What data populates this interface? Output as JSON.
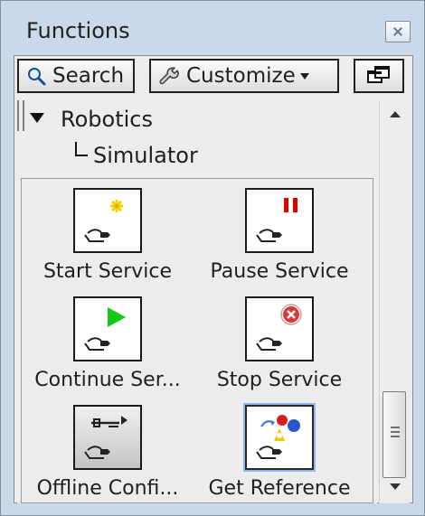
{
  "window": {
    "title": "Functions"
  },
  "toolbar": {
    "search_label": "Search",
    "customize_label": "Customize",
    "search_icon": "magnifier-icon",
    "customize_icon": "wrench-icon",
    "window_icon": "windows-icon"
  },
  "tree": {
    "root_label": "Robotics",
    "child_label": "Simulator"
  },
  "palette": {
    "items": [
      {
        "label": "Start Service",
        "icon": "start-service-icon"
      },
      {
        "label": "Pause Service",
        "icon": "pause-service-icon"
      },
      {
        "label": "Continue Ser...",
        "icon": "continue-service-icon"
      },
      {
        "label": "Stop Service",
        "icon": "stop-service-icon"
      },
      {
        "label": "Offline Confi...",
        "icon": "offline-config-icon"
      },
      {
        "label": "Get Reference",
        "icon": "get-reference-icon"
      }
    ]
  },
  "colors": {
    "frame": "#cad9ea",
    "panel": "#ececec",
    "accent_selection": "#8fb6e8",
    "start_icon_yellow": "#f2d400",
    "pause_icon_red": "#e00000",
    "continue_icon_green": "#16c816",
    "stop_icon_red": "#d83a3a"
  }
}
